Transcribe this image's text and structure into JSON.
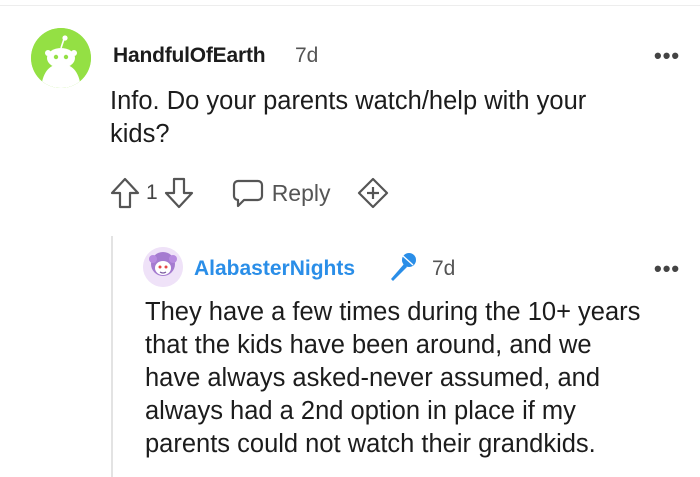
{
  "comments": [
    {
      "username": "HandfulOfEarth",
      "age": "7d",
      "body_lines": [
        "Info. Do your parents watch/help with your",
        "kids?"
      ],
      "votes": "1",
      "reply_label": "Reply",
      "menu": "•••"
    },
    {
      "username": "AlabasterNights",
      "age": "7d",
      "body_lines": [
        "They have a few times during the 10+ years",
        "that the kids have been around, and we",
        "have always asked-never assumed, and",
        "always had a 2nd option in place if my",
        "parents could not watch their grandkids."
      ],
      "menu": "•••"
    }
  ],
  "icons": {
    "parent_avatar": "snoo-avatar-icon",
    "reply_avatar": "custom-avatar-icon",
    "upvote": "arrow-up-icon",
    "downvote": "arrow-down-icon",
    "reply": "speech-bubble-icon",
    "award": "add-award-icon",
    "badge": "microphone-icon",
    "menu": "more-dots-icon"
  },
  "colors": {
    "snoo_green": "#94e044",
    "link_blue": "#2a8ee8",
    "badge_blue": "#2a8ee8"
  }
}
